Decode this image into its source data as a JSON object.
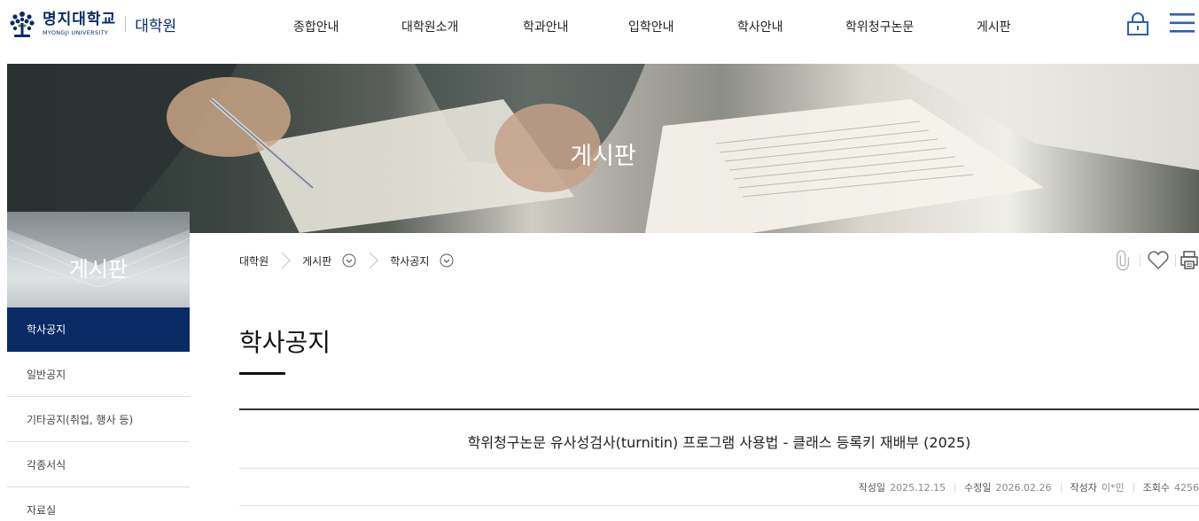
{
  "header": {
    "logo_name": "명지대학교",
    "logo_sub": "MYONGJI UNIVERSITY",
    "dept": "대학원",
    "nav": [
      "종합안내",
      "대학원소개",
      "학과안내",
      "입학안내",
      "학사안내",
      "학위청구논문",
      "게시판"
    ],
    "icons": [
      "lock-icon",
      "menu-icon"
    ],
    "brand_color": "#0a2a66"
  },
  "hero": {
    "title": "게시판"
  },
  "sidebar": {
    "title": "게시판",
    "items": [
      {
        "label": "학사공지",
        "active": true
      },
      {
        "label": "일반공지",
        "active": false
      },
      {
        "label": "기타공지(취업, 행사 등)",
        "active": false
      },
      {
        "label": "각종서식",
        "active": false
      },
      {
        "label": "자료실",
        "active": false
      }
    ]
  },
  "breadcrumb": {
    "home": "대학원",
    "level1": "게시판",
    "level2": "학사공지"
  },
  "utility_icons": [
    "attachment-icon",
    "heart-icon",
    "print-icon"
  ],
  "page_title": "학사공지",
  "article": {
    "subject": "학위청구논문 유사성검사(turnitin) 프로그램 사용법 - 클래스 등록키 재배부 (2025)",
    "created_label": "작성일",
    "created": "2025.12.15",
    "modified_label": "수정일",
    "modified": "2026.02.26",
    "author_label": "작성자",
    "author": "이*민",
    "views_label": "조회수",
    "views": "4256"
  }
}
